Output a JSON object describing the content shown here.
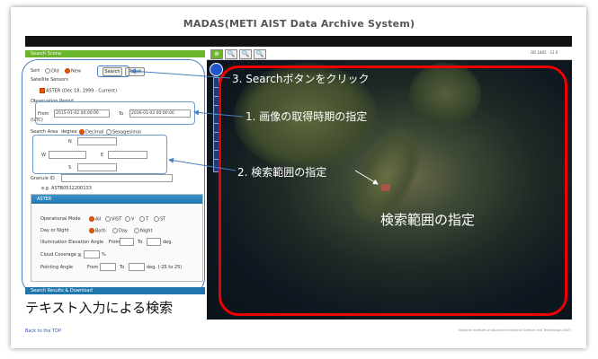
{
  "page_title": "MADAS(METI AIST Data Archive System)",
  "search_scene_label": "Search Scene",
  "map_toolbar": [
    "⊕",
    "🔍",
    "🔍",
    "🔍"
  ],
  "map_info": "OD 1805 · 21.6",
  "sort": {
    "label": "Sort",
    "options": [
      "Old",
      "New"
    ],
    "selected": "New"
  },
  "search_button": "Search",
  "reset_button": "Reset",
  "satellite_sensors_label": "Satellite Sensors",
  "aster_option": "ASTER  (Dec 18, 1999 - Current)",
  "observation_period_label": "Observation Period",
  "utc_label": "(UTC)",
  "from_label": "From",
  "from_value": "2015-01-02 00:00:00",
  "to_label": "To",
  "to_value": "2016-01-02 00:00:00",
  "search_area": {
    "label": "Search Area",
    "degree_label": "degree",
    "options": [
      "Decimal",
      "Sexagesimal"
    ],
    "selected": "Decimal"
  },
  "dirs": {
    "n": "N",
    "w": "W",
    "e": "E",
    "s": "S"
  },
  "granule_id_label": "Granule ID",
  "granule_example": "e.g. ASTB0512200133",
  "aster_header": "ASTER",
  "operational_mode": {
    "label": "Operational Mode",
    "options": [
      "All",
      "VIST",
      "V",
      "T",
      "ST"
    ],
    "selected": "All"
  },
  "day_or_night": {
    "label": "Day or Night",
    "options": [
      "Both",
      "Day",
      "Night"
    ],
    "selected": "Both"
  },
  "illumination_label": "Illumination Elevation Angle",
  "illum_from": "From",
  "illum_to": "To",
  "illum_unit": "deg.",
  "cloud_coverage_label": "Cloud Coverage ≦",
  "cloud_unit": "%",
  "pointing_label": "Pointing Angle",
  "pointing_from": "From",
  "pointing_to": "To",
  "pointing_unit": "deg. (-25 to 25)",
  "results_label": "Search Results & Download",
  "annotations": {
    "step3": "3. Searchボタンをクリック",
    "step1": "1. 画像の取得時期の指定",
    "step2": "2. 検索範囲の指定",
    "map_label": "検索範囲の指定",
    "caption": "テキスト入力による検索"
  },
  "back_to_top": "Back to the TOP",
  "footer": "National Institute of Advanced Industrial Science and Technology (AIST)",
  "colors": {
    "annotation_red": "#e00000",
    "accent_green": "#6ab52a",
    "accent_blue": "#1f76ad",
    "radio_on": "#e35a00"
  }
}
